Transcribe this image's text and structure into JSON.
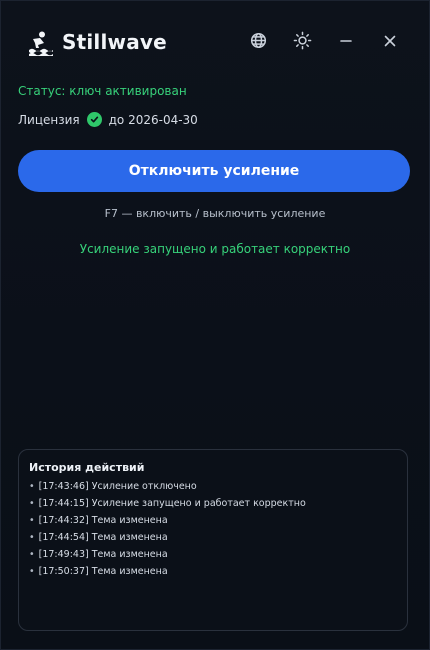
{
  "app": {
    "title": "Stillwave",
    "icons": {
      "logo": "swimmer-icon",
      "language": "globe-icon",
      "theme": "sun-icon",
      "minimize": "minimize-icon",
      "close": "close-icon"
    }
  },
  "status": {
    "text": "Статус: ключ активирован",
    "color": "#37d17a"
  },
  "license": {
    "label": "Лицензия",
    "valid_until": "до 2026-04-30",
    "icon": "check-circle-icon"
  },
  "main_button": {
    "label": "Отключить усиление",
    "color": "#2b69ea"
  },
  "hotkey_hint": "F7 — включить / выключить усиление",
  "state_message": "Усиление запущено и работает корректно",
  "history": {
    "title": "История действий",
    "entries": [
      "[17:43:46] Усиление отключено",
      "[17:44:15] Усиление запущено и работает корректно",
      "[17:44:32] Тема изменена",
      "[17:44:54] Тема изменена",
      "[17:49:43] Тема изменена",
      "[17:50:37] Тема изменена"
    ]
  }
}
